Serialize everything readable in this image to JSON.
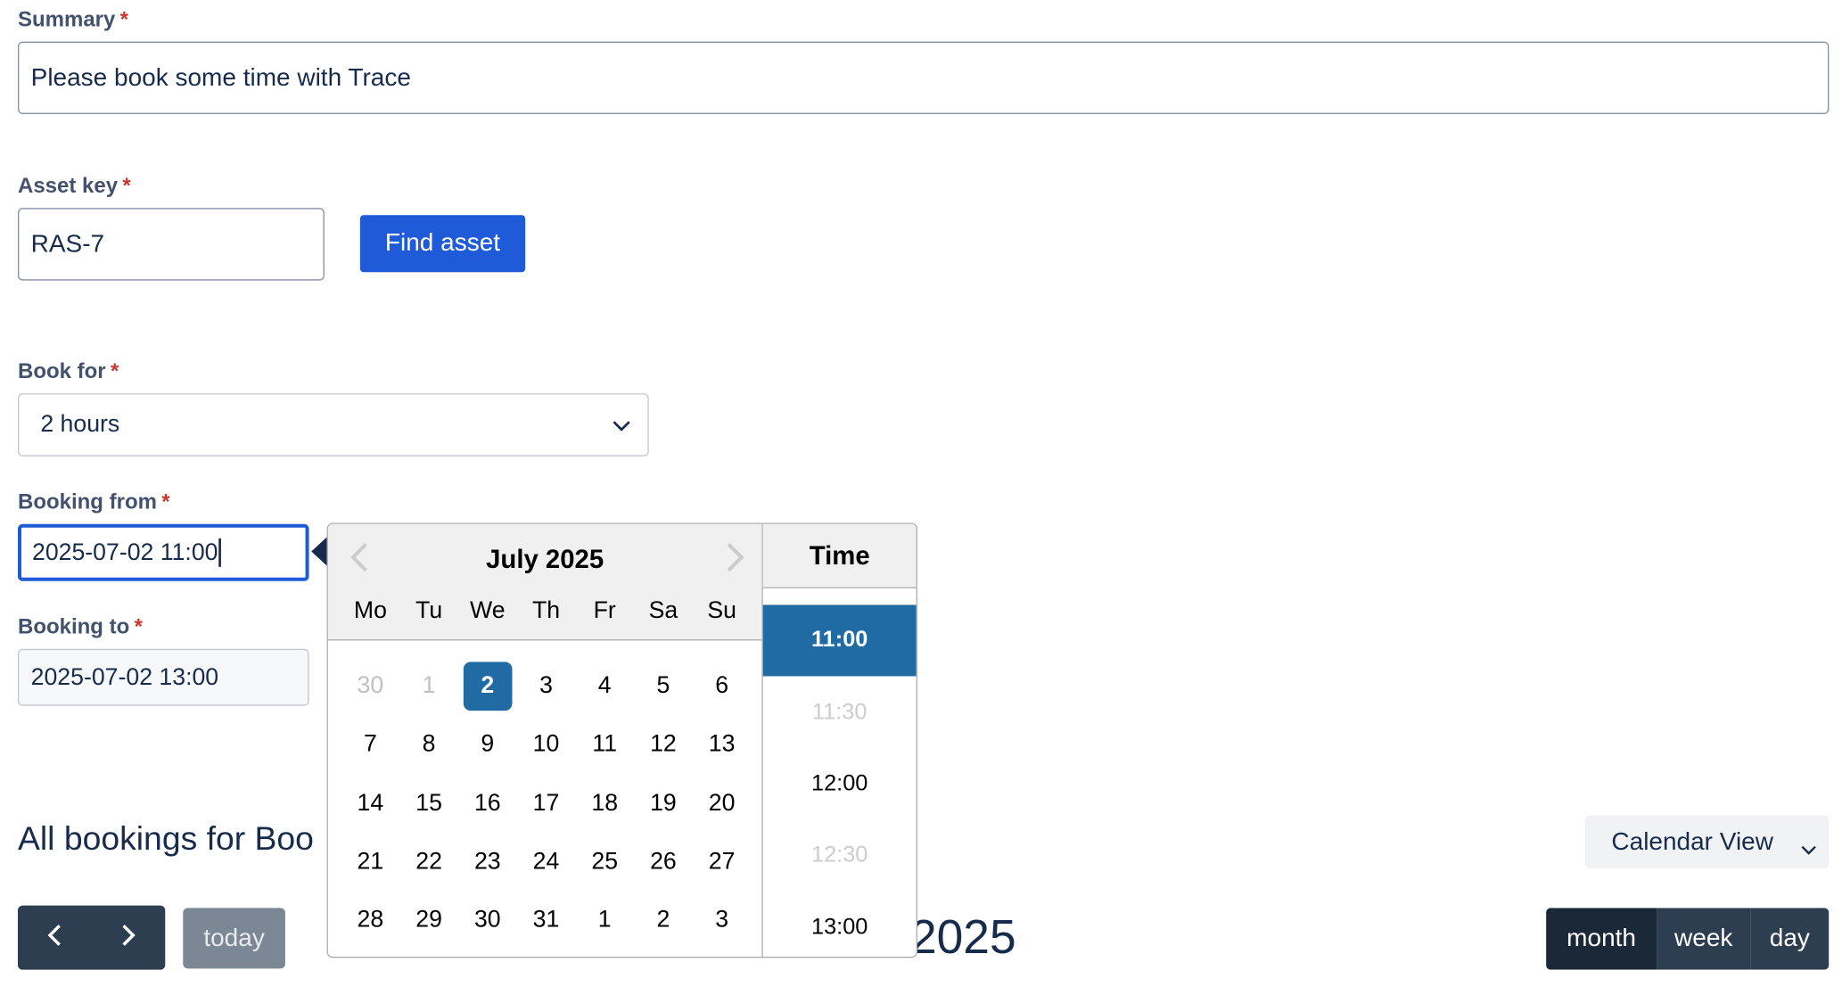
{
  "form": {
    "summary": {
      "label": "Summary",
      "required": "*",
      "value": "Please book some time with Trace"
    },
    "asset_key": {
      "label": "Asset key",
      "required": "*",
      "value": "RAS-7",
      "find_button": "Find asset"
    },
    "book_for": {
      "label": "Book for",
      "required": "*",
      "selected": "2 hours"
    },
    "booking_from": {
      "label": "Booking from",
      "required": "*",
      "value": "2025-07-02 11:00"
    },
    "booking_to": {
      "label": "Booking to",
      "required": "*",
      "value": "2025-07-02 13:00"
    }
  },
  "bookings": {
    "title": "All bookings for Boo",
    "view_select": "Calendar View",
    "today_label": "today",
    "calendar_title": "2025",
    "views": [
      "month",
      "week",
      "day"
    ],
    "active_view": "month"
  },
  "datepicker": {
    "month_title": "July 2025",
    "weekdays": [
      "Mo",
      "Tu",
      "We",
      "Th",
      "Fr",
      "Sa",
      "Su"
    ],
    "weeks": [
      [
        {
          "d": "30",
          "m": true
        },
        {
          "d": "1",
          "m": true
        },
        {
          "d": "2",
          "s": true
        },
        {
          "d": "3"
        },
        {
          "d": "4"
        },
        {
          "d": "5"
        },
        {
          "d": "6"
        }
      ],
      [
        {
          "d": "7"
        },
        {
          "d": "8"
        },
        {
          "d": "9"
        },
        {
          "d": "10"
        },
        {
          "d": "11"
        },
        {
          "d": "12"
        },
        {
          "d": "13"
        }
      ],
      [
        {
          "d": "14"
        },
        {
          "d": "15"
        },
        {
          "d": "16"
        },
        {
          "d": "17"
        },
        {
          "d": "18"
        },
        {
          "d": "19"
        },
        {
          "d": "20"
        }
      ],
      [
        {
          "d": "21"
        },
        {
          "d": "22"
        },
        {
          "d": "23"
        },
        {
          "d": "24"
        },
        {
          "d": "25"
        },
        {
          "d": "26"
        },
        {
          "d": "27"
        }
      ],
      [
        {
          "d": "28"
        },
        {
          "d": "29"
        },
        {
          "d": "30"
        },
        {
          "d": "31"
        },
        {
          "d": "1"
        },
        {
          "d": "2"
        },
        {
          "d": "3"
        }
      ]
    ],
    "time_header": "Time",
    "times": [
      {
        "t": "11:00",
        "state": "selected"
      },
      {
        "t": "11:30",
        "state": "disabled"
      },
      {
        "t": "12:00",
        "state": "normal"
      },
      {
        "t": "12:30",
        "state": "disabled"
      },
      {
        "t": "13:00",
        "state": "normal"
      }
    ]
  },
  "colors": {
    "primary": "#1f5bd8",
    "selected": "#216ba5",
    "required": "#c9372c",
    "dark_button": "#2c3e50"
  }
}
